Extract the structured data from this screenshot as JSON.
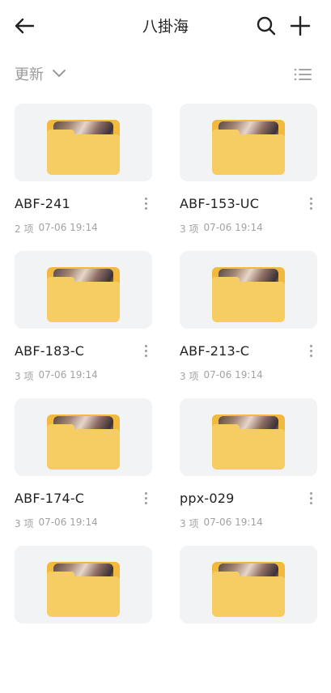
{
  "header": {
    "title": "八掛海"
  },
  "sort": {
    "label": "更新"
  },
  "items": [
    {
      "name": "ABF-241",
      "count": "2 项",
      "time": "07-06 19:14"
    },
    {
      "name": "ABF-153-UC",
      "count": "3 项",
      "time": "07-06 19:14"
    },
    {
      "name": "ABF-183-C",
      "count": "3 项",
      "time": "07-06 19:14"
    },
    {
      "name": "ABF-213-C",
      "count": "3 项",
      "time": "07-06 19:14"
    },
    {
      "name": "ABF-174-C",
      "count": "3 项",
      "time": "07-06 19:14"
    },
    {
      "name": "ppx-029",
      "count": "3 项",
      "time": "07-06 19:14"
    },
    {
      "name": "",
      "count": "",
      "time": ""
    },
    {
      "name": "",
      "count": "",
      "time": ""
    }
  ],
  "icons": {
    "back": "arrow-left-icon",
    "search": "search-icon",
    "add": "plus-icon",
    "sort": "chevron-down-icon",
    "list": "list-view-icon",
    "more": "more-vertical-icon",
    "folder": "folder-icon"
  },
  "colors": {
    "folder": "#f6cd62",
    "card": "#f2f3f5",
    "muted": "#a2a2a2"
  }
}
